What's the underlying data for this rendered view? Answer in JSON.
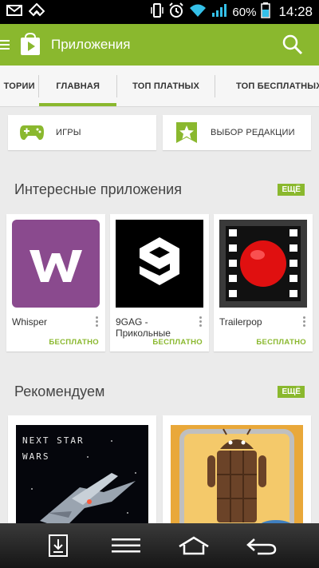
{
  "statusbar": {
    "battery_percent": "60%",
    "time": "14:28",
    "icons": [
      "gmail-icon",
      "feedly-icon",
      "phone-vibrate-icon",
      "alarm-icon",
      "wifi-icon",
      "signal-icon",
      "battery-icon"
    ]
  },
  "appbar": {
    "title": "Приложения",
    "color": "#8ab82e"
  },
  "tabs": [
    {
      "label": "ТОРИИ",
      "active": false
    },
    {
      "label": "ГЛАВНАЯ",
      "active": true
    },
    {
      "label": "ТОП ПЛАТНЫХ",
      "active": false
    },
    {
      "label": "ТОП БЕСПЛАТНЫХ",
      "active": false
    }
  ],
  "categories": [
    {
      "label": "ИГРЫ",
      "icon": "gamepad-icon"
    },
    {
      "label": "ВЫБОР РЕДАКЦИИ",
      "icon": "editors-choice-icon"
    }
  ],
  "sections": {
    "interesting": {
      "title": "Интересные приложения",
      "more_label": "ЕЩЁ"
    },
    "recommended": {
      "title": "Рекомендуем",
      "more_label": "ЕЩЁ"
    }
  },
  "apps": [
    {
      "name": "Whisper",
      "price": "БЕСПЛАТНО",
      "icon": "whisper-icon"
    },
    {
      "name": "9GAG - Прикольные",
      "price": "БЕСПЛАТНО",
      "icon": "9gag-icon"
    },
    {
      "name": "Trailerpop",
      "price": "БЕСПЛАТНО",
      "icon": "trailerpop-icon"
    }
  ],
  "recommended": [
    {
      "art_text_line1": "NEXT STAR",
      "art_text_line2": "WARS",
      "art": "space-game-art"
    },
    {
      "art": "android-kitkat-art"
    }
  ],
  "navbar": {
    "buttons": [
      "download-icon",
      "menu-icon",
      "home-icon",
      "back-icon"
    ]
  }
}
